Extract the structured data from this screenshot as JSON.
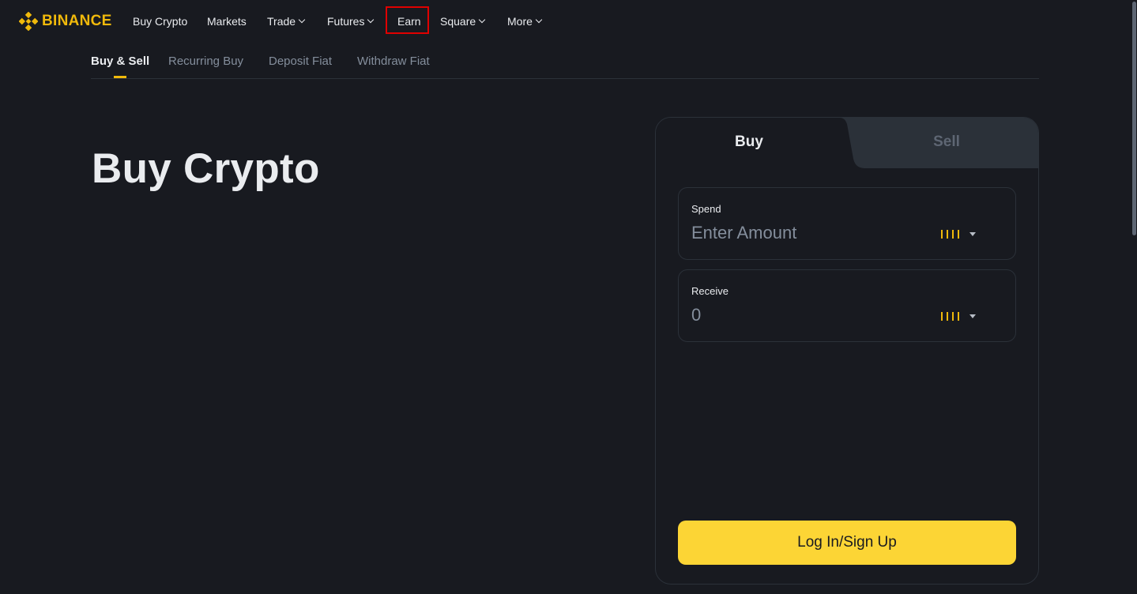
{
  "brand": {
    "name": "BINANCE",
    "color": "#f0b90b"
  },
  "nav": {
    "items": [
      {
        "label": "Buy Crypto",
        "dropdown": false
      },
      {
        "label": "Markets",
        "dropdown": false
      },
      {
        "label": "Trade",
        "dropdown": true
      },
      {
        "label": "Futures",
        "dropdown": true
      },
      {
        "label": "Earn",
        "dropdown": false,
        "highlighted": true
      },
      {
        "label": "Square",
        "dropdown": true
      },
      {
        "label": "More",
        "dropdown": true
      }
    ]
  },
  "subnav": {
    "tabs": [
      {
        "label": "Buy & Sell",
        "active": true
      },
      {
        "label": "Recurring Buy",
        "active": false
      },
      {
        "label": "Deposit Fiat",
        "active": false
      },
      {
        "label": "Withdraw Fiat",
        "active": false
      }
    ]
  },
  "main": {
    "title": "Buy Crypto"
  },
  "card": {
    "tabs": [
      {
        "label": "Buy",
        "active": true
      },
      {
        "label": "Sell",
        "active": false
      }
    ],
    "spend": {
      "label": "Spend",
      "placeholder": "Enter Amount",
      "value": "",
      "currency_icon": "loading-currency-icon"
    },
    "receive": {
      "label": "Receive",
      "value": "0",
      "currency_icon": "loading-currency-icon"
    },
    "login_label": "Log In/Sign Up",
    "accent": "#fcd535"
  }
}
